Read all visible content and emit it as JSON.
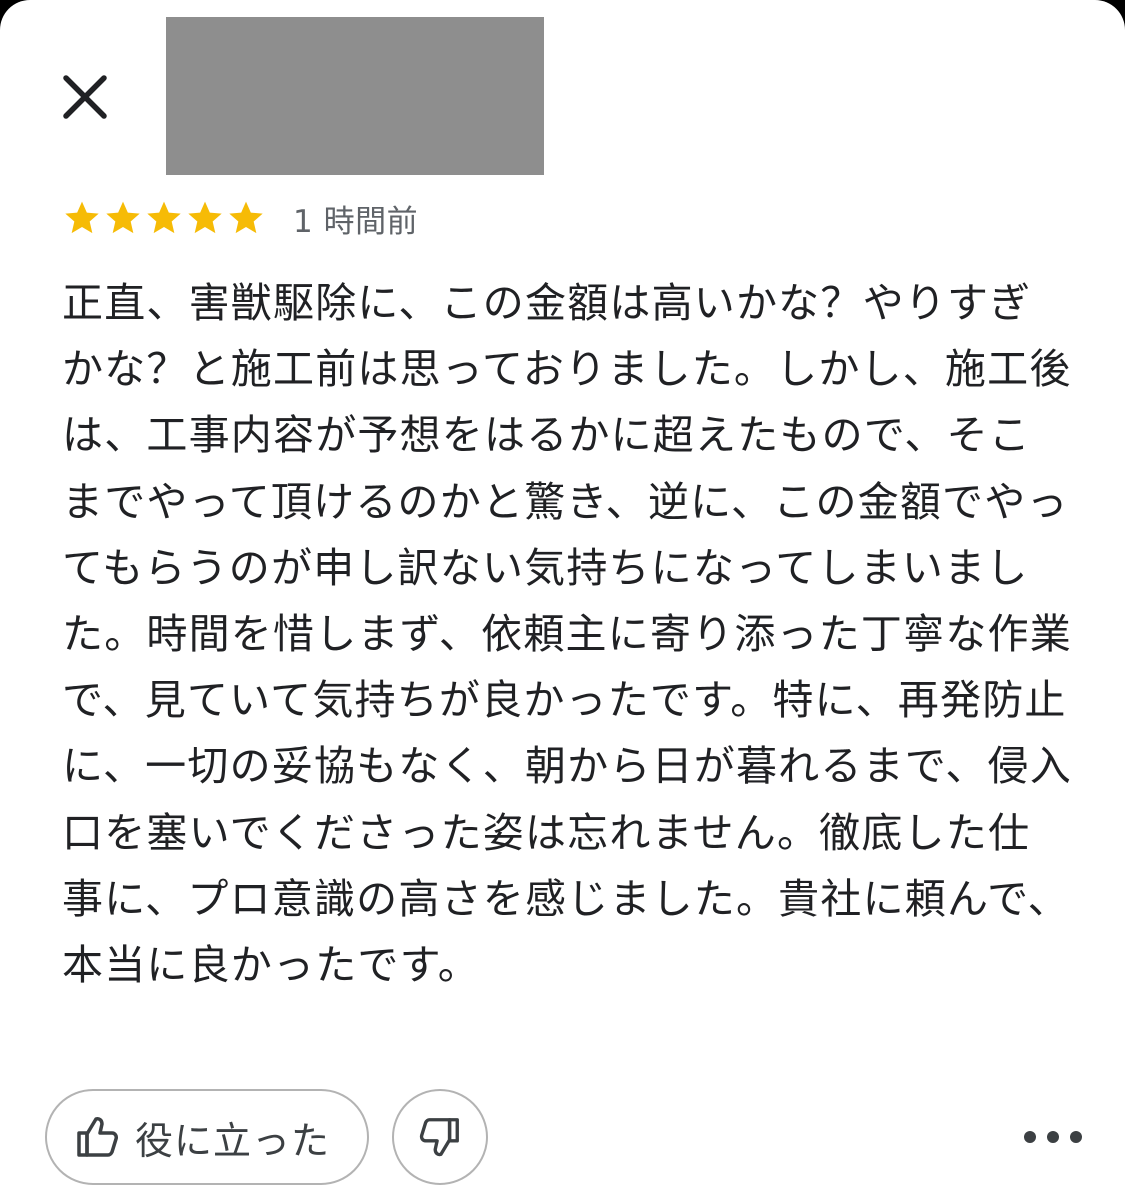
{
  "header": {
    "close_icon": "close-icon",
    "author_name_redacted": true
  },
  "review": {
    "rating": 5,
    "rating_max": 5,
    "star_color": "#f6bb06",
    "time_ago": "1 時間前",
    "text": "正直、害獣駆除に、この金額は高いかな？やりすぎかな？と施工前は思っておりました。しかし、施工後は、工事内容が予想をはるかに超えたもので、そこまでやって頂けるのかと驚き、逆に、この金額でやってもらうのが申し訳ない気持ちになってしまいました。時間を惜しまず、依頼主に寄り添った丁寧な作業で、見ていて気持ちが良かったです。特に、再発防止に、一切の妥協もなく、朝から日が暮れるまで、侵入口を塞いでくださった姿は忘れません。徹底した仕事に、プロ意識の高さを感じました。貴社に頼んで、本当に良かったです。"
  },
  "actions": {
    "helpful_label": "役に立った",
    "helpful_icon": "thumbs-up-icon",
    "not_helpful_icon": "thumbs-down-icon",
    "more_icon": "more-horizontal-icon"
  }
}
